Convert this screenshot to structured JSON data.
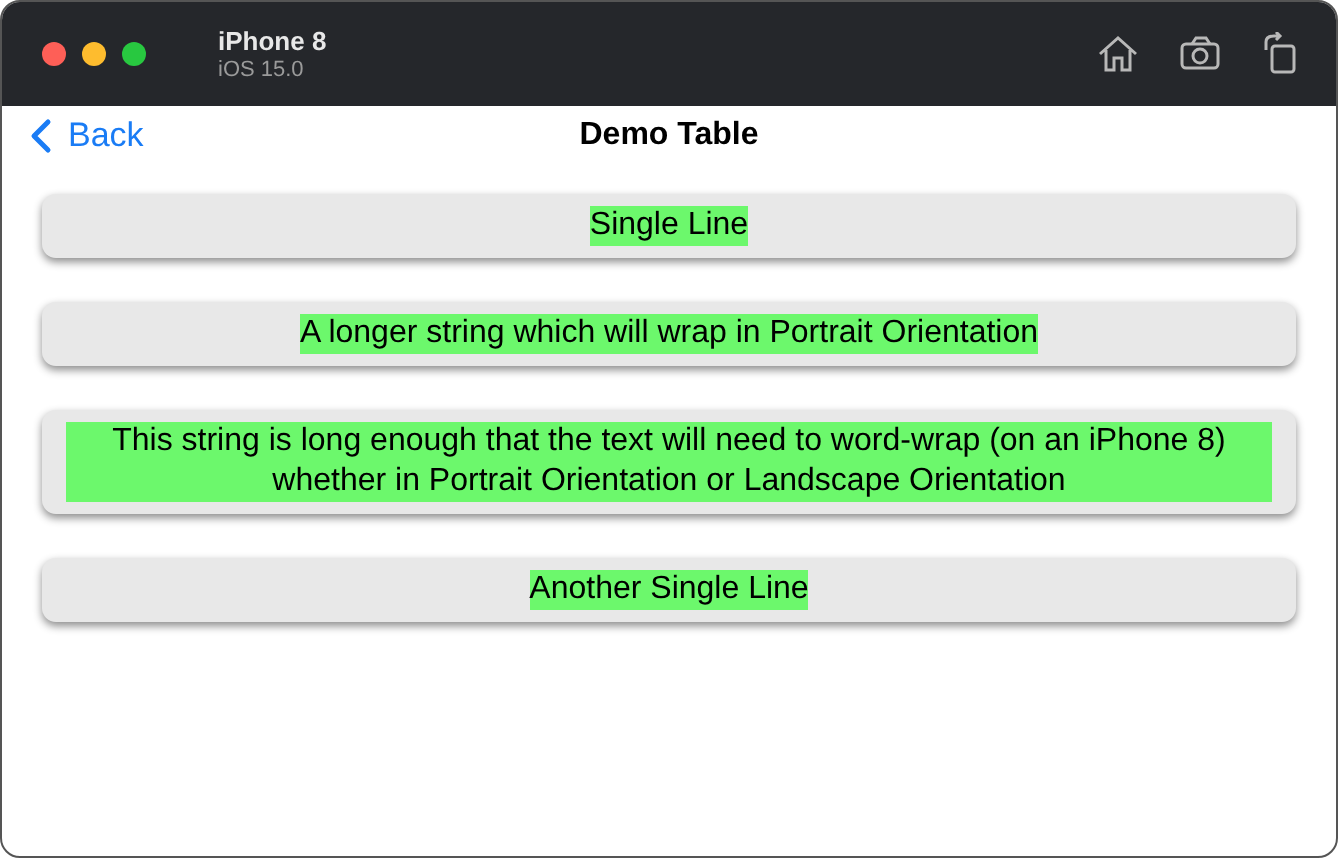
{
  "window": {
    "title": "iPhone 8",
    "subtitle": "iOS 15.0"
  },
  "nav": {
    "back": "Back",
    "title": "Demo Table"
  },
  "rows": [
    {
      "text": "Single Line"
    },
    {
      "text": "A longer string which will wrap in Portrait Orientation"
    },
    {
      "text": "This string is long enough that the text will need to word-wrap (on an iPhone 8) whether in Portrait Orientation or Landscape Orientation"
    },
    {
      "text": "Another Single Line"
    }
  ]
}
